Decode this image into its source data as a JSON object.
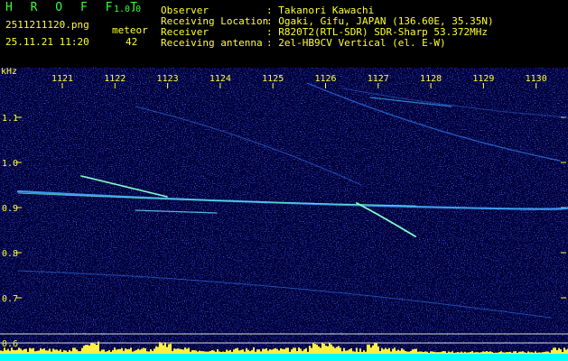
{
  "header": {
    "app_title": "H R O F F T",
    "version": "1.0.0",
    "filename": "2511211120.png",
    "datetime": "25.11.21 11:20",
    "meteor_label": "meteor",
    "meteor_count": "42",
    "info": [
      {
        "label": "Observer",
        "value": ": Takanori Kawachi"
      },
      {
        "label": "Receiving Location",
        "value": ": Ogaki, Gifu, JAPAN (136.60E, 35.35N)"
      },
      {
        "label": "Receiver",
        "value": ": R820T2(RTL-SDR) SDR-Sharp 53.372MHz"
      },
      {
        "label": "Receiving antenna",
        "value": ": 2el-HB9CV Vertical (el. E-W)"
      }
    ]
  },
  "axes": {
    "unit": "kHz",
    "time_labels": [
      "1121",
      "1122",
      "1123",
      "1124",
      "1125",
      "1126",
      "1127",
      "1128",
      "1129",
      "1130"
    ],
    "freq_labels": [
      "1.1",
      "1.0",
      "0.9",
      "0.8",
      "0.7",
      "0.6"
    ]
  },
  "colors": {
    "header_text": "#ffff33",
    "title_text": "#33ff33",
    "background": "#00003a",
    "power_bar": "#ffee44",
    "power_base": "#00ffff"
  }
}
